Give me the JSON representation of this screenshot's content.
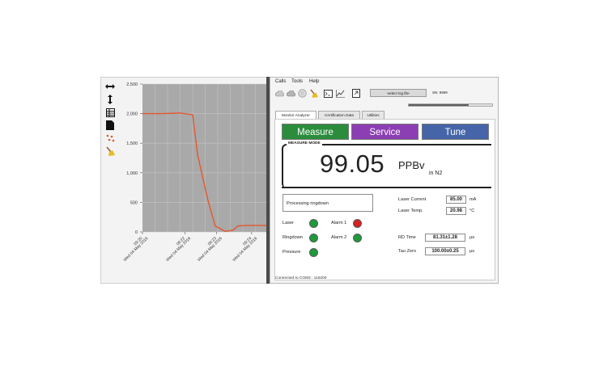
{
  "chart": {
    "toolbar_icons": [
      "horizontal-arrows-icon",
      "vertical-arrows-icon",
      "table-icon",
      "document-icon",
      "scatter-dots-icon",
      "broom-icon"
    ],
    "line_color": "#e4572e",
    "plot_bg": "#a9a9a9"
  },
  "chart_data": {
    "type": "line",
    "yticks": [
      "2,500",
      "2,000",
      "1,500",
      "1,000",
      "500",
      "0"
    ],
    "ytick_values": [
      2500,
      2000,
      1500,
      1000,
      500,
      0
    ],
    "ylim": [
      0,
      2500
    ],
    "xticks": [
      {
        "time": "09:20",
        "date": "Wed 04 May 2016"
      },
      {
        "time": "09:22",
        "date": "Wed 04 May 2016"
      },
      {
        "time": "09:23",
        "date": "Wed 04 May 2016"
      },
      {
        "time": "09:24",
        "date": "Wed 04 May 2016"
      }
    ],
    "xtick_pos": [
      0,
      0.34,
      0.59,
      0.87
    ],
    "series": [
      {
        "x": [
          0.0,
          0.16,
          0.3,
          0.4,
          0.44,
          0.52,
          0.58,
          0.66,
          0.72,
          0.76,
          0.82,
          1.0
        ],
        "y": [
          2000,
          2000,
          2010,
          1980,
          1300,
          550,
          100,
          10,
          30,
          100,
          110,
          110
        ]
      }
    ],
    "grid": true
  },
  "analyzer": {
    "menu": [
      "Calls",
      "Tools",
      "Help"
    ],
    "toolbar_icons": [
      "cloud-icon",
      "cloud-upload-icon",
      "cd-icon",
      "broom-icon",
      "terminal-icon",
      "chart-line-icon",
      "export-icon"
    ],
    "log_select": "-select log file-",
    "sn": "SN: 9999",
    "progress": 0.72,
    "tabs": [
      "Monitor Analyzer",
      "Certification Data",
      "Utilities"
    ],
    "modes": {
      "measure": "Measure",
      "service": "Service",
      "tune": "Tune"
    },
    "measure_mode_label": "MEASURE MODE",
    "value": "99.05",
    "unit": "PPBv",
    "unit_sub": "in N2",
    "status": "Processing ringdown",
    "indicators": {
      "laser": "Laser",
      "ringdown": "Ringdown",
      "pressure": "Pressure",
      "alarm1": "Alarm 1",
      "alarm2": "Alarm 2"
    },
    "led_colors": {
      "green": "#1e9a3a",
      "red": "#d32222"
    },
    "readings": {
      "laser_current_label": "Laser Current",
      "laser_current": "85.00",
      "laser_current_unit": "mA",
      "laser_temp_label": "Laser Temp.",
      "laser_temp": "20.98",
      "laser_temp_unit": "°C",
      "rd_time_label": "RD Time",
      "rd_time": "81.31±1.28",
      "rd_time_unit": "µs",
      "tau_zero_label": "Tau Zero",
      "tau_zero": "100.00±0.25",
      "tau_zero_unit": "µs"
    },
    "status_bar": "Connected to COM3 : 115200"
  }
}
